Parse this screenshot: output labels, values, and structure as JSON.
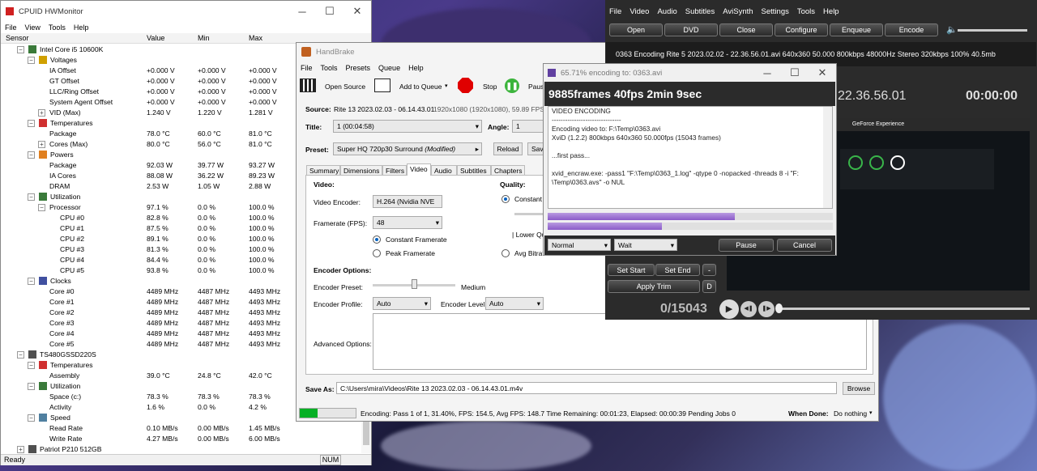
{
  "hwmonitor": {
    "title": "CPUID HWMonitor",
    "menu": [
      "File",
      "View",
      "Tools",
      "Help"
    ],
    "columns": {
      "sensor": "Sensor",
      "value": "Value",
      "min": "Min",
      "max": "Max"
    },
    "rows": [
      {
        "indent": 1,
        "tw": "−",
        "icon": "cpu-icon",
        "label": "Intel Core i5 10600K",
        "value": "",
        "min": "",
        "max": ""
      },
      {
        "indent": 2,
        "tw": "−",
        "icon": "voltage-icon",
        "label": "Voltages",
        "value": "",
        "min": "",
        "max": ""
      },
      {
        "indent": 3,
        "tw": "",
        "icon": "",
        "label": "IA Offset",
        "value": "+0.000 V",
        "min": "+0.000 V",
        "max": "+0.000 V"
      },
      {
        "indent": 3,
        "tw": "",
        "icon": "",
        "label": "GT Offset",
        "value": "+0.000 V",
        "min": "+0.000 V",
        "max": "+0.000 V"
      },
      {
        "indent": 3,
        "tw": "",
        "icon": "",
        "label": "LLC/Ring Offset",
        "value": "+0.000 V",
        "min": "+0.000 V",
        "max": "+0.000 V"
      },
      {
        "indent": 3,
        "tw": "",
        "icon": "",
        "label": "System Agent Offset",
        "value": "+0.000 V",
        "min": "+0.000 V",
        "max": "+0.000 V"
      },
      {
        "indent": 3,
        "tw": "+",
        "icon": "",
        "label": "VID (Max)",
        "value": "1.240 V",
        "min": "1.220 V",
        "max": "1.281 V"
      },
      {
        "indent": 2,
        "tw": "−",
        "icon": "thermometer-icon",
        "label": "Temperatures",
        "value": "",
        "min": "",
        "max": ""
      },
      {
        "indent": 3,
        "tw": "",
        "icon": "",
        "label": "Package",
        "value": "78.0 °C",
        "min": "60.0 °C",
        "max": "81.0 °C"
      },
      {
        "indent": 3,
        "tw": "+",
        "icon": "",
        "label": "Cores (Max)",
        "value": "80.0 °C",
        "min": "56.0 °C",
        "max": "81.0 °C"
      },
      {
        "indent": 2,
        "tw": "−",
        "icon": "power-icon",
        "label": "Powers",
        "value": "",
        "min": "",
        "max": ""
      },
      {
        "indent": 3,
        "tw": "",
        "icon": "",
        "label": "Package",
        "value": "92.03 W",
        "min": "39.77 W",
        "max": "93.27 W"
      },
      {
        "indent": 3,
        "tw": "",
        "icon": "",
        "label": "IA Cores",
        "value": "88.08 W",
        "min": "36.22 W",
        "max": "89.23 W"
      },
      {
        "indent": 3,
        "tw": "",
        "icon": "",
        "label": "DRAM",
        "value": "2.53 W",
        "min": "1.05 W",
        "max": "2.88 W"
      },
      {
        "indent": 2,
        "tw": "−",
        "icon": "utilization-icon",
        "label": "Utilization",
        "value": "",
        "min": "",
        "max": ""
      },
      {
        "indent": 3,
        "tw": "−",
        "icon": "",
        "label": "Processor",
        "value": "97.1 %",
        "min": "0.0 %",
        "max": "100.0 %"
      },
      {
        "indent": 4,
        "tw": "",
        "icon": "",
        "label": "CPU #0",
        "value": "82.8 %",
        "min": "0.0 %",
        "max": "100.0 %"
      },
      {
        "indent": 4,
        "tw": "",
        "icon": "",
        "label": "CPU #1",
        "value": "87.5 %",
        "min": "0.0 %",
        "max": "100.0 %"
      },
      {
        "indent": 4,
        "tw": "",
        "icon": "",
        "label": "CPU #2",
        "value": "89.1 %",
        "min": "0.0 %",
        "max": "100.0 %"
      },
      {
        "indent": 4,
        "tw": "",
        "icon": "",
        "label": "CPU #3",
        "value": "81.3 %",
        "min": "0.0 %",
        "max": "100.0 %"
      },
      {
        "indent": 4,
        "tw": "",
        "icon": "",
        "label": "CPU #4",
        "value": "84.4 %",
        "min": "0.0 %",
        "max": "100.0 %"
      },
      {
        "indent": 4,
        "tw": "",
        "icon": "",
        "label": "CPU #5",
        "value": "93.8 %",
        "min": "0.0 %",
        "max": "100.0 %"
      },
      {
        "indent": 2,
        "tw": "−",
        "icon": "clock-icon",
        "label": "Clocks",
        "value": "",
        "min": "",
        "max": ""
      },
      {
        "indent": 3,
        "tw": "",
        "icon": "",
        "label": "Core #0",
        "value": "4489 MHz",
        "min": "4487 MHz",
        "max": "4493 MHz"
      },
      {
        "indent": 3,
        "tw": "",
        "icon": "",
        "label": "Core #1",
        "value": "4489 MHz",
        "min": "4487 MHz",
        "max": "4493 MHz"
      },
      {
        "indent": 3,
        "tw": "",
        "icon": "",
        "label": "Core #2",
        "value": "4489 MHz",
        "min": "4487 MHz",
        "max": "4493 MHz"
      },
      {
        "indent": 3,
        "tw": "",
        "icon": "",
        "label": "Core #3",
        "value": "4489 MHz",
        "min": "4487 MHz",
        "max": "4493 MHz"
      },
      {
        "indent": 3,
        "tw": "",
        "icon": "",
        "label": "Core #4",
        "value": "4489 MHz",
        "min": "4487 MHz",
        "max": "4493 MHz"
      },
      {
        "indent": 3,
        "tw": "",
        "icon": "",
        "label": "Core #5",
        "value": "4489 MHz",
        "min": "4487 MHz",
        "max": "4493 MHz"
      },
      {
        "indent": 1,
        "tw": "−",
        "icon": "drive-icon",
        "label": "TS480GSSD220S",
        "value": "",
        "min": "",
        "max": ""
      },
      {
        "indent": 2,
        "tw": "−",
        "icon": "thermometer-icon",
        "label": "Temperatures",
        "value": "",
        "min": "",
        "max": ""
      },
      {
        "indent": 3,
        "tw": "",
        "icon": "",
        "label": "Assembly",
        "value": "39.0 °C",
        "min": "24.8 °C",
        "max": "42.0 °C"
      },
      {
        "indent": 2,
        "tw": "−",
        "icon": "utilization-icon",
        "label": "Utilization",
        "value": "",
        "min": "",
        "max": ""
      },
      {
        "indent": 3,
        "tw": "",
        "icon": "",
        "label": "Space (c:)",
        "value": "78.3 %",
        "min": "78.3 %",
        "max": "78.3 %"
      },
      {
        "indent": 3,
        "tw": "",
        "icon": "",
        "label": "Activity",
        "value": "1.6 %",
        "min": "0.0 %",
        "max": "4.2 %"
      },
      {
        "indent": 2,
        "tw": "−",
        "icon": "speed-icon",
        "label": "Speed",
        "value": "",
        "min": "",
        "max": ""
      },
      {
        "indent": 3,
        "tw": "",
        "icon": "",
        "label": "Read Rate",
        "value": "0.10 MB/s",
        "min": "0.00 MB/s",
        "max": "1.45 MB/s"
      },
      {
        "indent": 3,
        "tw": "",
        "icon": "",
        "label": "Write Rate",
        "value": "4.27 MB/s",
        "min": "0.00 MB/s",
        "max": "6.00 MB/s"
      },
      {
        "indent": 1,
        "tw": "+",
        "icon": "drive-icon",
        "label": "Patriot P210 512GB",
        "value": "",
        "min": "",
        "max": ""
      }
    ],
    "status": {
      "ready": "Ready",
      "num": "NUM"
    }
  },
  "handbrake": {
    "title": "HandBrake",
    "menu": [
      "File",
      "Tools",
      "Presets",
      "Queue",
      "Help"
    ],
    "toolbar": {
      "open_source": "Open Source",
      "add_to_queue": "Add to Queue",
      "stop": "Stop",
      "pause": "Paus"
    },
    "source_label": "Source:",
    "source_name": "Rite 13 2023.02.03 - 06.14.43.01",
    "source_info": "1920x1080 (1920x1080), 59.89 FPS, 1 A",
    "title_label": "Title:",
    "title_value": "1 (00:04:58)",
    "angle_label": "Angle:",
    "angle_value": "1",
    "preset_label": "Preset:",
    "preset_value": "Super HQ 720p30 Surround",
    "preset_modified": "(Modified)",
    "reload": "Reload",
    "save": "Sav",
    "tabs": [
      "Summary",
      "Dimensions",
      "Filters",
      "Video",
      "Audio",
      "Subtitles",
      "Chapters"
    ],
    "video": {
      "heading": "Video:",
      "encoder_label": "Video Encoder:",
      "encoder_value": "H.264 (Nvidia NVE",
      "framerate_label": "Framerate (FPS):",
      "framerate_value": "48",
      "constant_framerate": "Constant Framerate",
      "peak_framerate": "Peak Framerate",
      "quality_heading": "Quality:",
      "constant_quality": "Constant",
      "lower_quality": "| Lower Qu",
      "avg_bitrate": "Avg Bitrat",
      "encoder_options": "Encoder Options:",
      "encoder_preset_label": "Encoder Preset:",
      "encoder_preset_value": "Medium",
      "encoder_profile_label": "Encoder Profile:",
      "encoder_profile_value": "Auto",
      "encoder_level_label": "Encoder Level:",
      "encoder_level_value": "Auto",
      "advanced_options": "Advanced Options:"
    },
    "save_as_label": "Save As:",
    "save_as_value": "C:\\Users\\mira\\Videos\\Rite 13 2023.02.03 - 06.14.43.01.m4v",
    "browse": "Browse",
    "status_text": "Encoding: Pass 1 of 1,  31.40%, FPS: 154.5,  Avg FPS: 148.7 Time Remaining: 00:01:23,  Elapsed: 00:00:39   Pending Jobs 0",
    "progress": 0.314,
    "when_done_label": "When Done:",
    "when_done_value": "Do nothing"
  },
  "megui": {
    "menu": [
      "File",
      "Video",
      "Audio",
      "Subtitles",
      "AviSynth",
      "Settings",
      "Tools",
      "Help"
    ],
    "buttons": [
      "Open",
      "DVD",
      "Close",
      "Configure",
      "Enqueue",
      "Encode"
    ],
    "info": "0363   Encoding   Rite 5 2023.02.02 - 22.36.56.01.avi   640x360  50.000  800kbps  48000Hz  Stereo  320kbps  100%  40.5mb",
    "overlay_title": "22.36.56.01",
    "overlay_time": "00:00:00",
    "set_start": "Set Start",
    "set_end": "Set End",
    "minus": "-",
    "apply_trim": "Apply Trim",
    "d": "D",
    "frame_counter": "0/15043",
    "preview_title": "GeForce Experience"
  },
  "progress_dialog": {
    "title": "65.71% encoding to: 0363.avi",
    "headline": "9885frames 40fps 2min 9sec",
    "log": [
      "VIDEO ENCODING",
      "-------------------------------",
      "Encoding video to: F:\\Temp\\0363.avi",
      "XviD (1.2.2) 800kbps 640x360 50.000fps (15043 frames)",
      "",
      "...first pass...",
      "",
      "xvid_encraw.exe: -pass1 \"F:\\Temp\\0363_1.log\" -qtype 0 -nopacked -threads 8 -i \"F:",
      "\\Temp\\0363.avs\" -o NUL"
    ],
    "bar1": 0.6571,
    "bar2": 0.4,
    "priority": "Normal",
    "wait": "Wait",
    "pause": "Pause",
    "cancel": "Cancel"
  }
}
